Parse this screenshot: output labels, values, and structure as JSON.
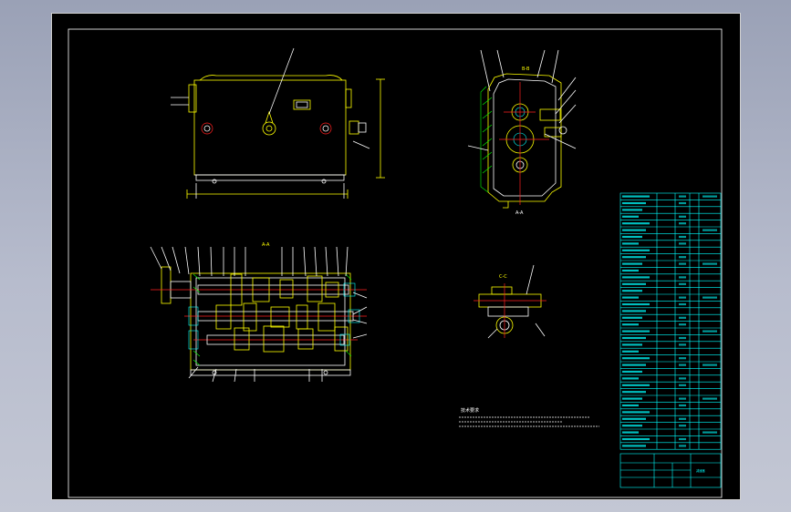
{
  "drawing": {
    "views": {
      "section_a_label": "A-A",
      "section_b_label": "B-B",
      "section_c_label": "C-C"
    },
    "notes_title": "技术要求",
    "title_block_name": "减速器"
  },
  "colors": {
    "background": "#000000",
    "outline": "#ffff00",
    "line": "#ffffff",
    "centerline": "#ff2020",
    "table": "#00ffff",
    "hatch": "#00ff00"
  }
}
